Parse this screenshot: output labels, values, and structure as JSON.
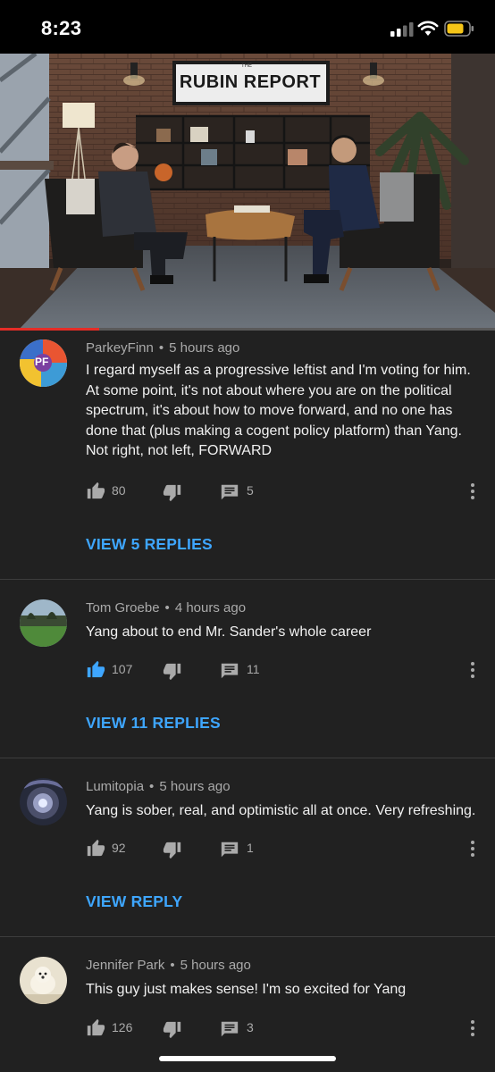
{
  "status_bar": {
    "time": "8:23"
  },
  "video": {
    "sign_top": "THE",
    "sign_text": "RUBIN REPORT",
    "progress_fraction": 0.2
  },
  "comments": [
    {
      "author": "ParkeyFinn",
      "time": "5 hours ago",
      "text": "I regard myself as a progressive leftist and I'm voting for him. At some point, it's not about where you are on the political spectrum, it's about how to move forward, and no one has done that (plus making a cogent policy platform) than Yang. Not right, not left, FORWARD",
      "likes": "80",
      "replies_count": "5",
      "replies_link": "VIEW 5 REPLIES",
      "avatar_text": "PF",
      "liked": false
    },
    {
      "author": "Tom Groebe",
      "time": "4 hours ago",
      "text": "Yang about to end Mr. Sander's whole career",
      "likes": "107",
      "replies_count": "11",
      "replies_link": "VIEW 11 REPLIES",
      "liked": true
    },
    {
      "author": "Lumitopia",
      "time": "5 hours ago",
      "text": "Yang is sober, real, and optimistic all at once. Very refreshing.",
      "likes": "92",
      "replies_count": "1",
      "replies_link": "VIEW REPLY",
      "liked": false
    },
    {
      "author": "Jennifer Park",
      "time": "5 hours ago",
      "text": "This guy just makes sense! I'm so excited for Yang",
      "likes": "126",
      "replies_count": "3",
      "liked": false
    }
  ],
  "colors": {
    "accent": "#3ea6ff",
    "background": "#212121",
    "progress": "#e52d27"
  }
}
